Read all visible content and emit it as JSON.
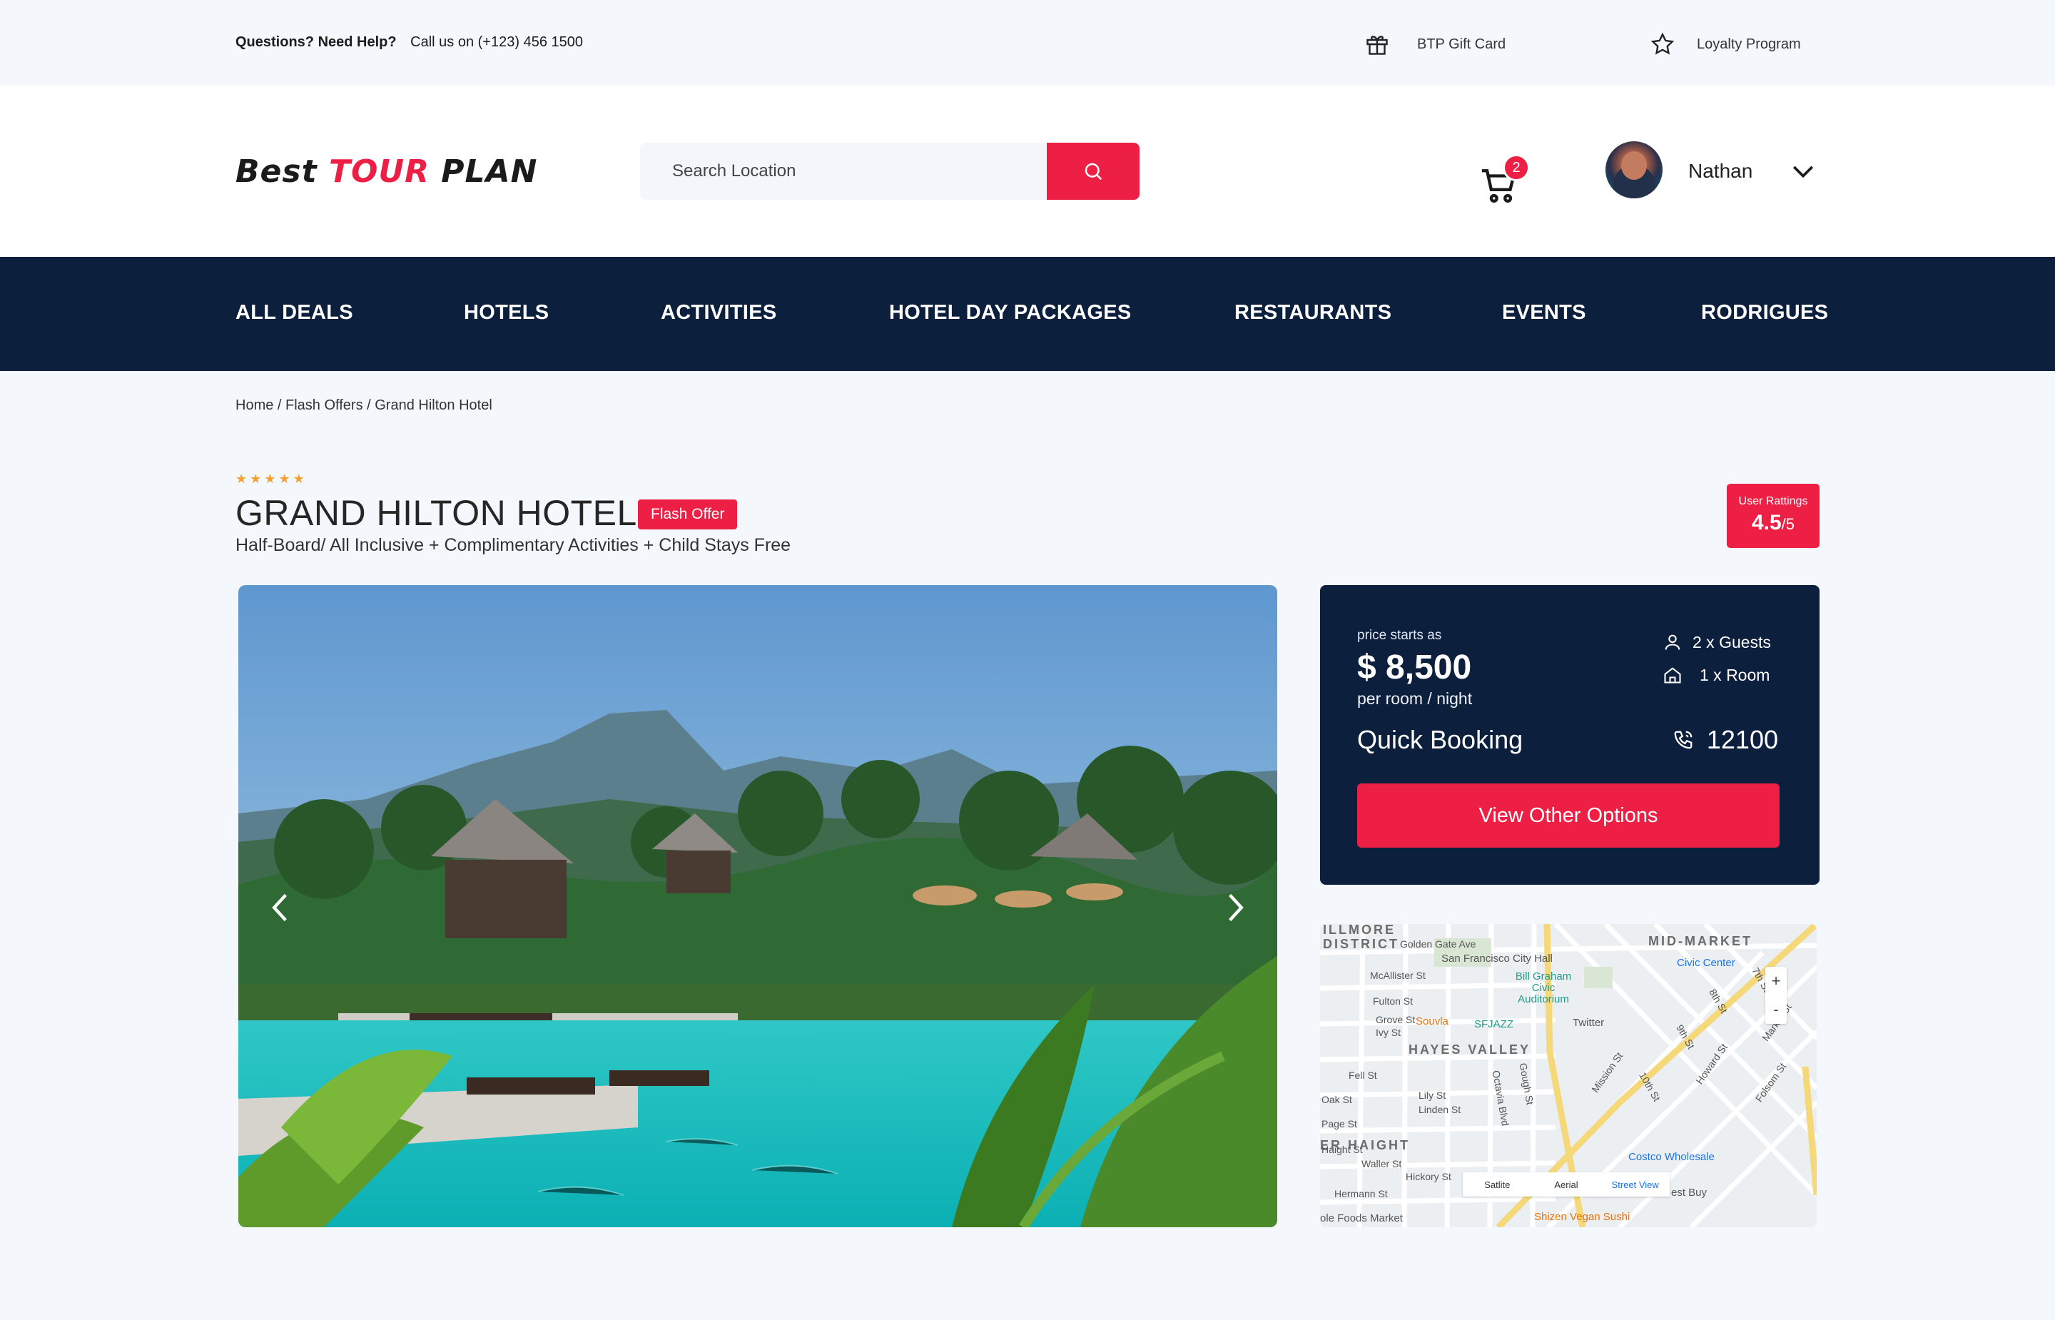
{
  "topbar": {
    "help_bold": "Questions? Need Help?",
    "help_text": "Call us on (+123) 456 1500",
    "gift_card": "BTP Gift Card",
    "loyalty": "Loyalty Program"
  },
  "header": {
    "logo_part1": "Best",
    "logo_part2": "TOUR",
    "logo_part3": "PLAN",
    "search_placeholder": "Search Location",
    "cart_count": "2",
    "user_name": "Nathan"
  },
  "nav": {
    "items": [
      "ALL DEALS",
      "HOTELS",
      "ACTIVITIES",
      "HOTEL DAY PACKAGES",
      "RESTAURANTS",
      "EVENTS",
      "RODRIGUES"
    ]
  },
  "breadcrumb": "Home / Flash Offers / Grand Hilton Hotel",
  "hotel": {
    "stars": 5,
    "title": "GRAND HILTON HOTEL",
    "badge": "Flash Offer",
    "subtitle": "Half-Board/ All Inclusive + Complimentary Activities + Child Stays Free",
    "rating_label": "User Rattings",
    "rating_value": "4.5",
    "rating_max": "/5"
  },
  "booking": {
    "price_label": "price starts as",
    "price": "$ 8,500",
    "unit": "per room / night",
    "guests": "2 x Guests",
    "rooms": "1 x Room",
    "quick_booking": "Quick Booking",
    "phone": "12100",
    "button": "View Other Options"
  },
  "map": {
    "districts": [
      "ILLMORE",
      "DISTRICT",
      "MID-MARKET",
      "HAYES VALLEY",
      "ER HAIGHT"
    ],
    "pois": [
      "San Francisco City Hall",
      "Bill Graham Civic Auditorium",
      "Civic Center",
      "Souvla",
      "SFJAZZ",
      "Twitter",
      "Costco Wholesale",
      "est Buy",
      "ole Foods Market",
      "Shizen Vegan Sushi"
    ],
    "streets": [
      "Golden Gate Ave",
      "McAllister St",
      "Fulton St",
      "Grove St",
      "Ivy St",
      "Fell St",
      "Oak St",
      "Page St",
      "Haight St",
      "Waller St",
      "Hermann St",
      "Octavia Blvd",
      "Gough St",
      "Mission St",
      "Howard St",
      "Folsom St",
      "8th St",
      "7th St",
      "9th St",
      "10th St",
      "Market St",
      "Lily St",
      "Linden St",
      "Hickory St"
    ],
    "tabs": [
      "Satlite",
      "Aerial",
      "Street View"
    ],
    "zoom_in": "+",
    "zoom_out": "-"
  }
}
